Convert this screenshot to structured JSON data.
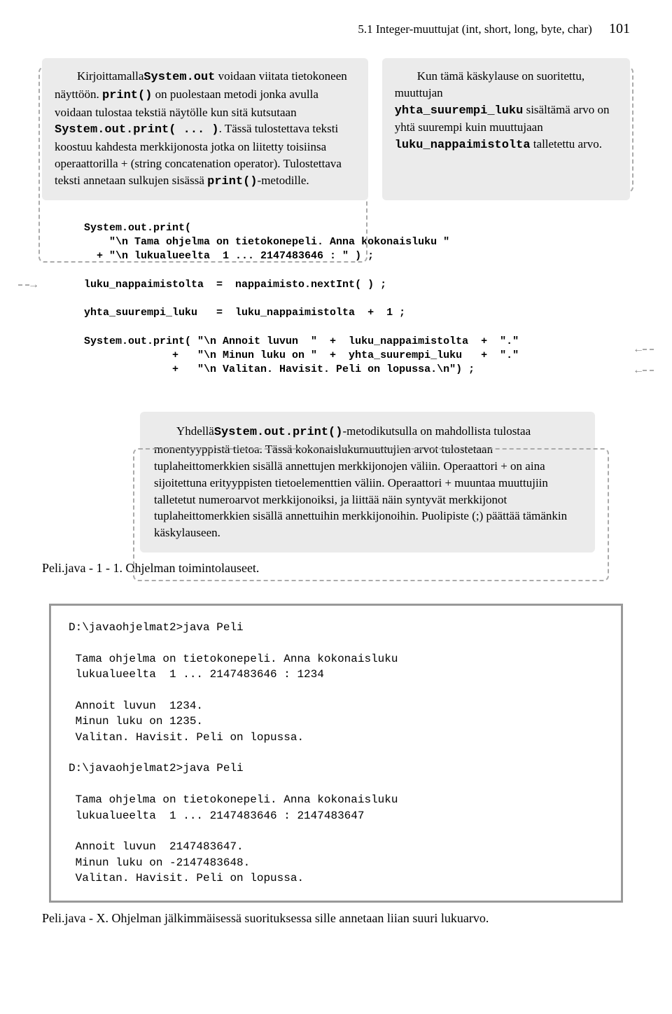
{
  "header": {
    "section_title": "5.1 Integer-muuttujat (int, short, long, byte, char)",
    "page_number": "101"
  },
  "callout_left": {
    "p1a": "Kirjoittamalla ",
    "p1code1": "System.out",
    "p1b": " voidaan viitata tietokoneen näyttöön. ",
    "p1code2": "print()",
    "p1c": " on puolestaan metodi jonka avulla voidaan tulostaa tekstiä näytölle kun sitä kutsutaan ",
    "p1code3": "System.out.print( ... )",
    "p1d": ". Tässä tulostettava teksti koostuu kahdesta merkkijonosta jotka on liitetty toisiinsa operaattorilla + (string concatenation operator). Tulostettava teksti annetaan sulkujen sisässä ",
    "p1code4": "print()",
    "p1e": "-metodille."
  },
  "callout_right": {
    "p1a": "Kun tämä käskylause on suoritettu, muuttujan ",
    "p1code1": "yhta_suurempi_luku",
    "p1b": " sisältämä arvo on yhtä suurempi kuin muuttujaan ",
    "p1code2": "luku_nappaimistolta",
    "p1c": " talletettu arvo."
  },
  "code": "System.out.print(\n    \"\\n Tama ohjelma on tietokonepeli. Anna kokonaisluku \"\n  + \"\\n lukualueelta  1 ... 2147483646 : \" ) ;\n\nluku_nappaimistolta  =  nappaimisto.nextInt( ) ;\n\nyhta_suurempi_luku   =  luku_nappaimistolta  +  1 ;\n\nSystem.out.print( \"\\n Annoit luvun  \"  +  luku_nappaimistolta  +  \".\"\n              +   \"\\n Minun luku on \"  +  yhta_suurempi_luku   +  \".\"\n              +   \"\\n Valitan. Havisit. Peli on lopussa.\\n\") ;",
  "callout_bottom": {
    "p1a": "Yhdellä ",
    "p1code1": "System.out.print()",
    "p1b": "-metodikutsulla on mahdollista tulostaa monentyyppistä tietoa. Tässä kokonaislukumuuttujien arvot tulostetaan tuplaheittomerkkien sisällä annettujen merkkijonojen väliin. Operaattori + on aina sijoitettuna erityyppisten tietoelementtien väliin. Operaattori + muuntaa muuttujiin talletetut numeroarvot merkkijonoiksi, ja liittää näin syntyvät merkkijonot tuplaheittomerkkien sisällä annettuihin merkkijonoihin. Puolipiste (;) päättää tämänkin käskylauseen."
  },
  "caption1": "Peli.java - 1 - 1.  Ohjelman toimintolauseet.",
  "console": "D:\\javaohjelmat2>java Peli\n\n Tama ohjelma on tietokonepeli. Anna kokonaisluku\n lukualueelta  1 ... 2147483646 : 1234\n\n Annoit luvun  1234.\n Minun luku on 1235.\n Valitan. Havisit. Peli on lopussa.\n\nD:\\javaohjelmat2>java Peli\n\n Tama ohjelma on tietokonepeli. Anna kokonaisluku\n lukualueelta  1 ... 2147483646 : 2147483647\n\n Annoit luvun  2147483647.\n Minun luku on -2147483648.\n Valitan. Havisit. Peli on lopussa.",
  "caption2": "Peli.java - X.  Ohjelman jälkimmäisessä suorituksessa sille annetaan liian suuri lukuarvo."
}
